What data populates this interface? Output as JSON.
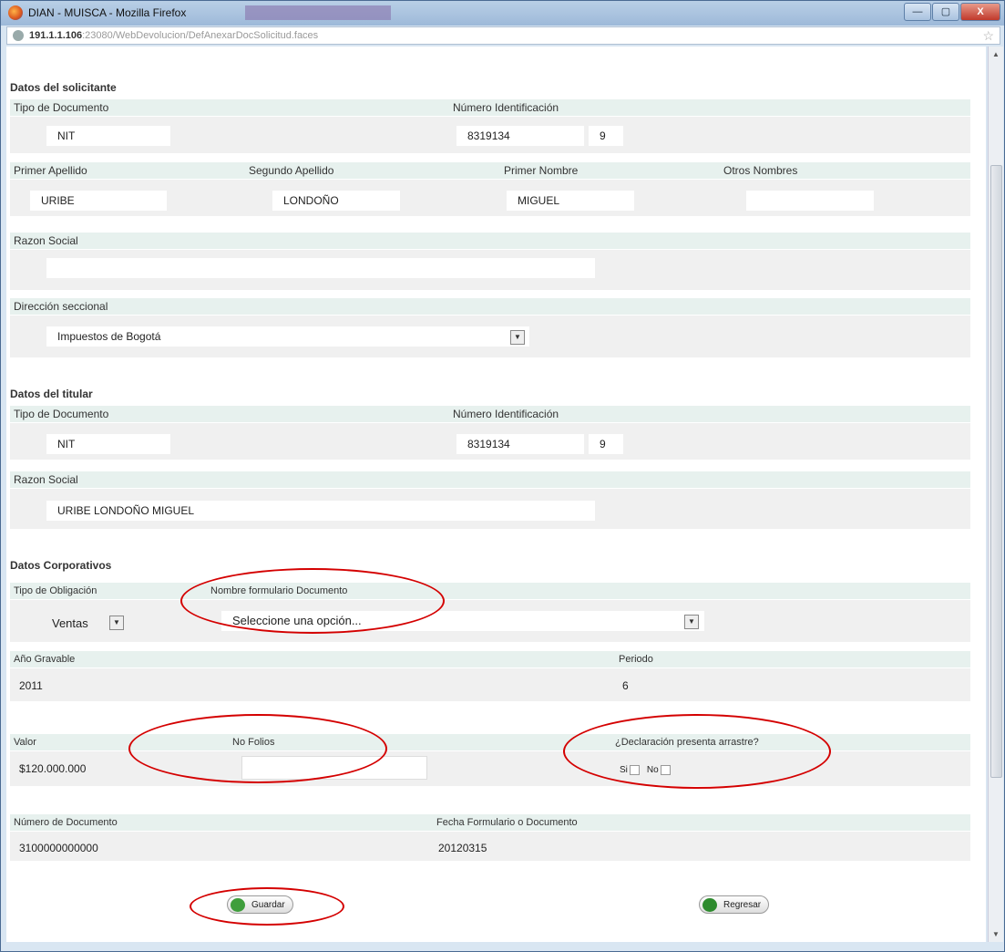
{
  "window": {
    "title": "DIAN - MUISCA - Mozilla Firefox",
    "buttons": {
      "minimize": "—",
      "maximize": "▢",
      "close": "X"
    }
  },
  "browser": {
    "url_host": "191.1.1.106",
    "url_path": ":23080/WebDevolucion/DefAnexarDocSolicitud.faces"
  },
  "solicitante": {
    "section": "Datos del solicitante",
    "tipo_doc_label": "Tipo de Documento",
    "tipo_doc": "NIT",
    "num_id_label": "Número Identificación",
    "num_id": "8319134",
    "dv": "9",
    "primer_apellido_label": "Primer Apellido",
    "primer_apellido": "URIBE",
    "segundo_apellido_label": "Segundo Apellido",
    "segundo_apellido": "LONDOÑO",
    "primer_nombre_label": "Primer Nombre",
    "primer_nombre": "MIGUEL",
    "otros_nombres_label": "Otros Nombres",
    "otros_nombres": "",
    "razon_social_label": "Razon Social",
    "razon_social": "",
    "direccion_label": "Dirección seccional",
    "direccion": "Impuestos de Bogotá"
  },
  "titular": {
    "section": "Datos del titular",
    "tipo_doc_label": "Tipo de Documento",
    "tipo_doc": "NIT",
    "num_id_label": "Número Identificación",
    "num_id": "8319134",
    "dv": "9",
    "razon_social_label": "Razon Social",
    "razon_social": "URIBE LONDOÑO MIGUEL"
  },
  "corporativos": {
    "section": "Datos Corporativos",
    "tipo_obligacion_label": "Tipo de Obligación",
    "tipo_obligacion": "Ventas",
    "nombre_formulario_label": "Nombre formulario Documento",
    "nombre_formulario": "Seleccione una opción...",
    "anio_label": "Año Gravable",
    "anio": "2011",
    "periodo_label": "Periodo",
    "periodo": "6",
    "valor_label": "Valor",
    "valor": "$120.000.000",
    "folios_label": "No Folios",
    "folios": "",
    "arrastre_label": "¿Declaración presenta arrastre?",
    "si": "Si",
    "no": "No",
    "num_doc_label": "Número de Documento",
    "num_doc": "3100000000000",
    "fecha_label": "Fecha Formulario o Documento",
    "fecha": "20120315"
  },
  "actions": {
    "guardar": "Guardar",
    "regresar": "Regresar"
  },
  "colors": {
    "annotation": "#d40000",
    "label_bg": "#e7f1ee",
    "row_bg": "#f0f0f0"
  }
}
